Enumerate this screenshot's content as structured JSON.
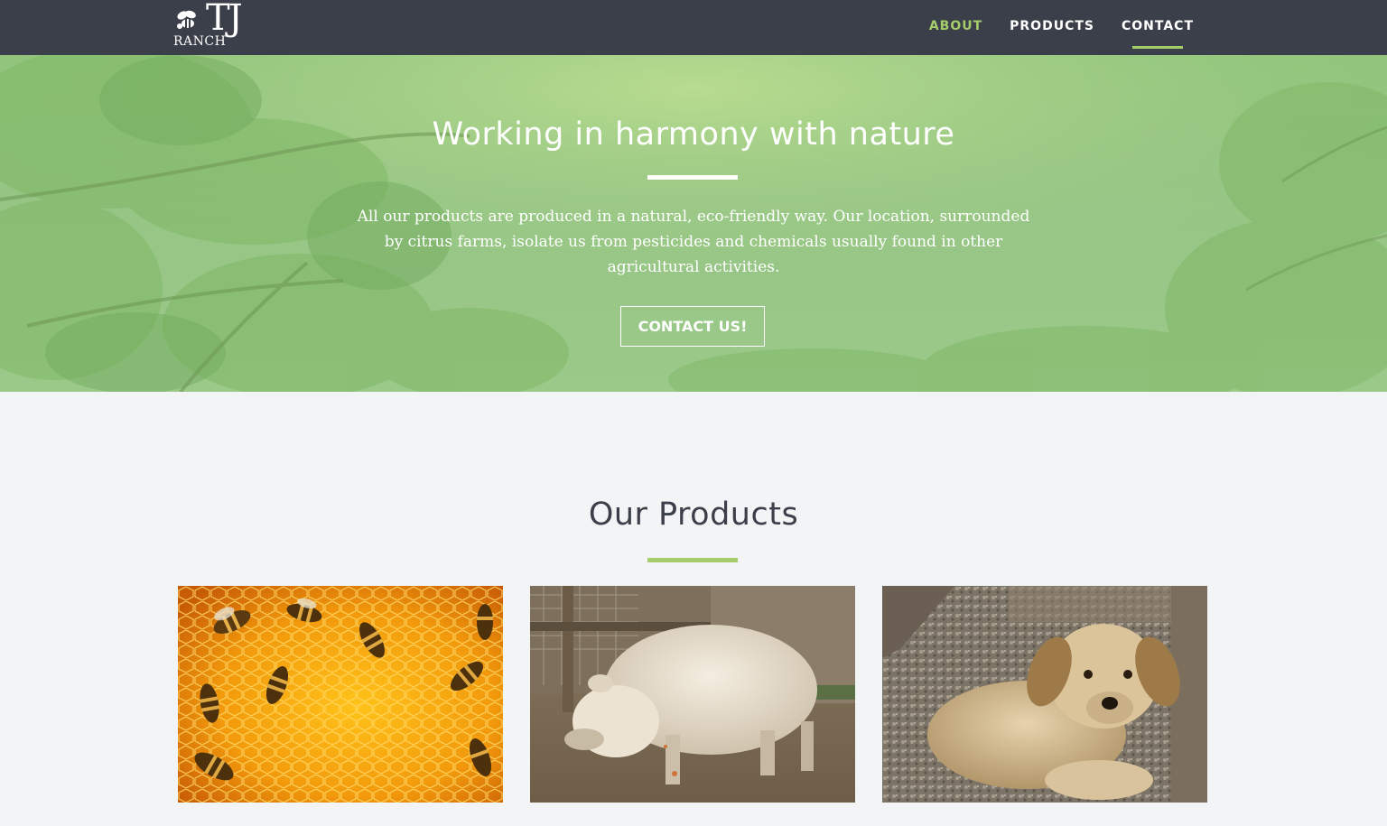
{
  "brand": {
    "logo_main": "TJ",
    "logo_sub": "RANCH",
    "logo_icon": "bee-icon"
  },
  "nav": {
    "items": [
      {
        "label": "ABOUT",
        "state": "accent"
      },
      {
        "label": "PRODUCTS",
        "state": "normal"
      },
      {
        "label": "CONTACT",
        "state": "active"
      }
    ]
  },
  "hero": {
    "title": "Working in harmony with nature",
    "text": "All our products are produced in a natural, eco-friendly way. Our location, surrounded by citrus farms, isolate us from pesticides and chemicals usually found in other agricultural activities.",
    "button_label": "CONTACT US!"
  },
  "products": {
    "title": "Our Products",
    "items": [
      {
        "image": "bees-on-honeycomb"
      },
      {
        "image": "woolly-pig"
      },
      {
        "image": "puppy"
      }
    ]
  },
  "colors": {
    "navbar_bg": "#3b3f49",
    "accent": "#a5cc6b",
    "page_bg": "#f3f4f6",
    "hero_green": "#96c585",
    "heading_dark": "#3b3f49"
  }
}
